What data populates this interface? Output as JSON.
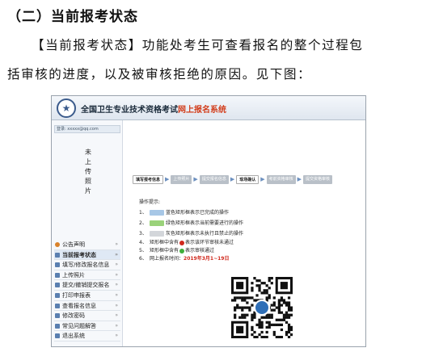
{
  "heading": "（二）当前报考状态",
  "paragraph": {
    "line1": "【当前报考状态】功能处考生可查看报名的整个过程包",
    "line2": "括审核的进度，以及被审核拒绝的原因。见下图："
  },
  "screenshot": {
    "banner_prefix": "全国卫生专业技术资格考试",
    "banner_suffix": "网上报名系统",
    "side_top": "登录: xxxxx@qq.com",
    "photo_chars": [
      "未",
      "上",
      "传",
      "照",
      "片"
    ],
    "menu": [
      "公告声明",
      "当前报考状态",
      "填写/修改报名信息",
      "上传照片",
      "提交/撤销提交报名",
      "打印申报表",
      "查看报名信息",
      "修改密码",
      "常见问题解答",
      "退出系统"
    ],
    "steps": [
      "填写报考信息",
      "上传照片",
      "提交报名信息",
      "现场确认",
      "考前资格审核",
      "提交资格审核"
    ],
    "tips_title": "操作提示:",
    "tips": [
      {
        "num": "1、",
        "text": "蓝色矩形框表示已完成的操作"
      },
      {
        "num": "2、",
        "text": "绿色矩形框表示当前需要进行的操作"
      },
      {
        "num": "3、",
        "text": "灰色矩形框表示未执行且禁止的操作"
      },
      {
        "num": "4、",
        "text_a": "矩形框中含有",
        "text_b": "表示该环节审核未通过"
      },
      {
        "num": "5、",
        "text_a": "矩形框中含有",
        "text_b": "表示审核通过"
      },
      {
        "num": "6、",
        "text_a": "网上报名时间：",
        "text_b": "2019年3月1~19日"
      }
    ],
    "colors": {
      "done": "#5a9bd5",
      "current": "#6fbf4a",
      "pending": "#b9c0c8",
      "fail": "#d0281c",
      "pass": "#3fae3a"
    }
  }
}
